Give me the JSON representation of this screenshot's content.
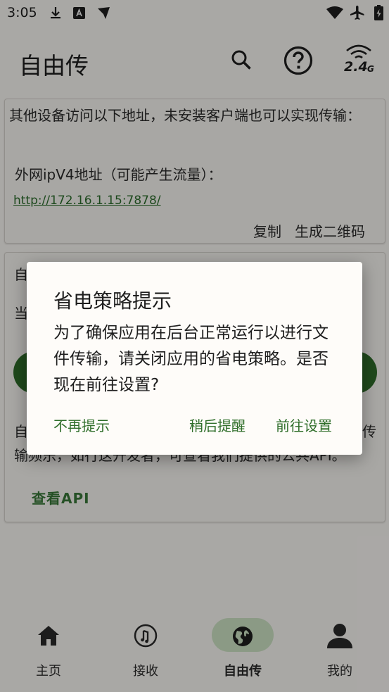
{
  "status_bar": {
    "time": "3:05",
    "colors": {
      "text": "#1e1e1e"
    }
  },
  "app_bar": {
    "title": "自由传",
    "wifi_band": "2.4",
    "wifi_unit": "G"
  },
  "card_access": {
    "description": "其他设备访问以下地址，未安装客户端也可以实现传输：",
    "address_label": "外网ipV4地址（可能产生流量）：",
    "address_url": "http://172.16.1.15:7878/",
    "copy_label": "复制",
    "qrcode_label": "生成二维码"
  },
  "card_api": {
    "peek_top_char": "自",
    "peek_mid_char": "当",
    "peek_line_left": "自",
    "peek_line_right": "传",
    "peek_line2": "输频乐，如行这开发者，可查看我们提供的公共API。",
    "api_button_label": "查看API"
  },
  "dialog": {
    "title": "省电策略提示",
    "message": "为了确保应用在后台正常运行以进行文件传输，请关闭应用的省电策略。是否现在前往设置?",
    "btn_no_remind": "不再提示",
    "btn_later": "稍后提醒",
    "btn_go_settings": "前往设置",
    "accent_color": "#2f6e2a"
  },
  "bottom_nav": {
    "items": [
      {
        "label": "主页",
        "icon": "home-icon"
      },
      {
        "label": "接收",
        "icon": "music-disc-icon"
      },
      {
        "label": "自由传",
        "icon": "globe-icon",
        "selected": true
      },
      {
        "label": "我的",
        "icon": "person-icon"
      }
    ]
  }
}
